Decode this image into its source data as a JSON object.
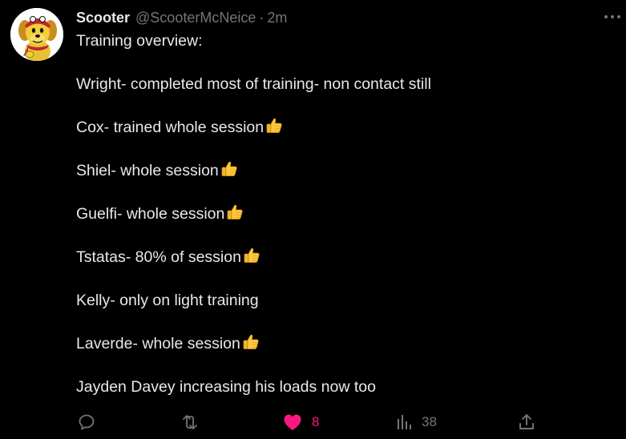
{
  "tweet": {
    "display_name": "Scooter",
    "handle": "@ScooterMcNeice",
    "separator": "·",
    "time": "2m",
    "avatar_icon": "cartoon-dog-avatar",
    "more_icon": "more-horizontal-icon",
    "lines": [
      {
        "text": "Training overview:",
        "emoji": false
      },
      {
        "text": "Wright- completed most of training- non contact still",
        "emoji": false
      },
      {
        "text": "Cox- trained whole session",
        "emoji": true
      },
      {
        "text": "Shiel- whole session",
        "emoji": true
      },
      {
        "text": "Guelfi- whole session",
        "emoji": true
      },
      {
        "text": "Tstatas- 80% of session",
        "emoji": true
      },
      {
        "text": "Kelly- only on light training",
        "emoji": false
      },
      {
        "text": "Laverde- whole session",
        "emoji": true
      },
      {
        "text": "Jayden Davey increasing his loads now too",
        "emoji": false
      }
    ]
  },
  "actions": {
    "reply": {
      "icon": "reply-icon",
      "count": ""
    },
    "retweet": {
      "icon": "retweet-icon",
      "count": ""
    },
    "like": {
      "icon": "heart-filled-icon",
      "count": "8",
      "active": true
    },
    "views": {
      "icon": "views-bar-chart-icon",
      "count": "38"
    },
    "share": {
      "icon": "share-icon",
      "count": ""
    }
  },
  "colors": {
    "background": "#000000",
    "text_primary": "#e7e9ea",
    "text_secondary": "#71767b",
    "like_active": "#f91880",
    "emoji_yellow": "#ffc83d"
  }
}
